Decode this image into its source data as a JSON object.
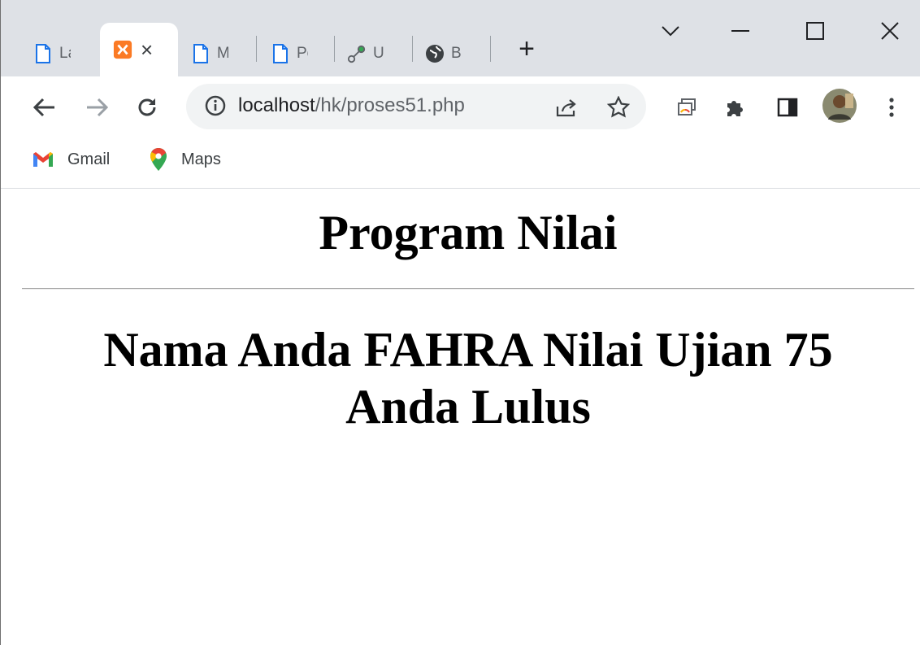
{
  "browser": {
    "tabs": [
      {
        "label": "La",
        "icon": "page-icon"
      },
      {
        "label": "",
        "icon": "xampp-icon",
        "active": true
      },
      {
        "label": "M",
        "icon": "page-icon"
      },
      {
        "label": "Pe",
        "icon": "page-icon"
      },
      {
        "label": "U",
        "icon": "link-icon"
      },
      {
        "label": "B",
        "icon": "globe-icon"
      }
    ],
    "close_glyph": "×",
    "new_tab_glyph": "+",
    "url_host": "localhost",
    "url_path": "/hk/proses51.php",
    "bookmarks": [
      {
        "label": "Gmail",
        "icon": "gmail-icon"
      },
      {
        "label": "Maps",
        "icon": "maps-icon"
      }
    ]
  },
  "page": {
    "title": "Program Nilai",
    "result_line1": "Nama Anda FAHRA Nilai Ujian 75",
    "result_line2": "Anda Lulus"
  }
}
